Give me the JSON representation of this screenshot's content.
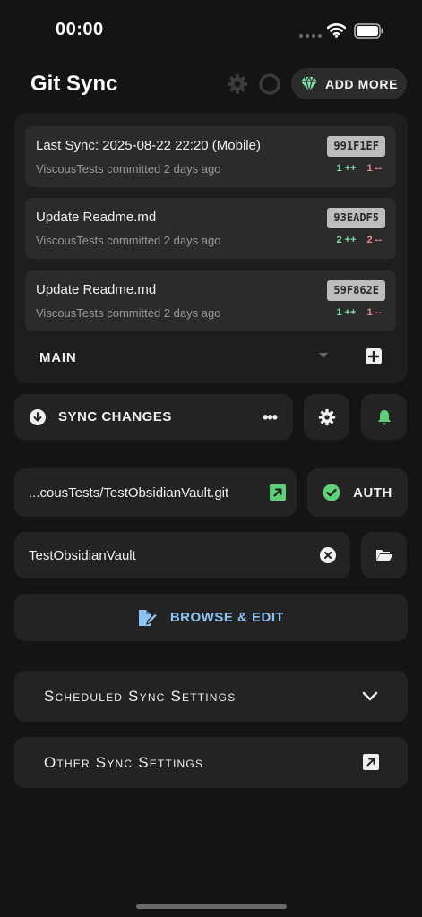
{
  "status_bar": {
    "time": "00:00"
  },
  "header": {
    "title": "Git Sync",
    "add_more_label": "ADD MORE"
  },
  "commits": [
    {
      "message": "Last Sync: 2025-08-22 22:20 (Mobile)",
      "author_line": "ViscousTests committed 2 days ago",
      "sha": "991F1EF",
      "additions": "1 ++",
      "deletions": "1 --"
    },
    {
      "message": "Update Readme.md",
      "author_line": "ViscousTests committed 2 days ago",
      "sha": "93EADF5",
      "additions": "2 ++",
      "deletions": "2 --"
    },
    {
      "message": "Update Readme.md",
      "author_line": "ViscousTests committed 2 days ago",
      "sha": "59F862E",
      "additions": "1 ++",
      "deletions": "1 --"
    }
  ],
  "branch": {
    "name": "MAIN"
  },
  "sync": {
    "label": "SYNC CHANGES",
    "more": "•••"
  },
  "remote": {
    "url": "...cousTests/TestObsidianVault.git",
    "auth_label": "AUTH"
  },
  "vault": {
    "name": "TestObsidianVault"
  },
  "browse": {
    "label": "BROWSE & EDIT"
  },
  "sections": {
    "scheduled": "Scheduled Sync Settings",
    "other": "Other Sync Settings"
  },
  "colors": {
    "background": "#141414",
    "card": "#232323",
    "accent_green": "#5fd07a",
    "accent_blue": "#8ec3f5",
    "addition": "#7ee0a8",
    "deletion": "#f08a8a"
  },
  "icons": [
    "wifi-icon",
    "battery-icon",
    "gear-icon",
    "ring-icon",
    "diamond-icon",
    "plus-icon",
    "download-icon",
    "bell-icon",
    "external-link-icon",
    "check-circle-icon",
    "clear-icon",
    "folder-open-icon",
    "edit-file-icon",
    "chevron-down-icon"
  ]
}
